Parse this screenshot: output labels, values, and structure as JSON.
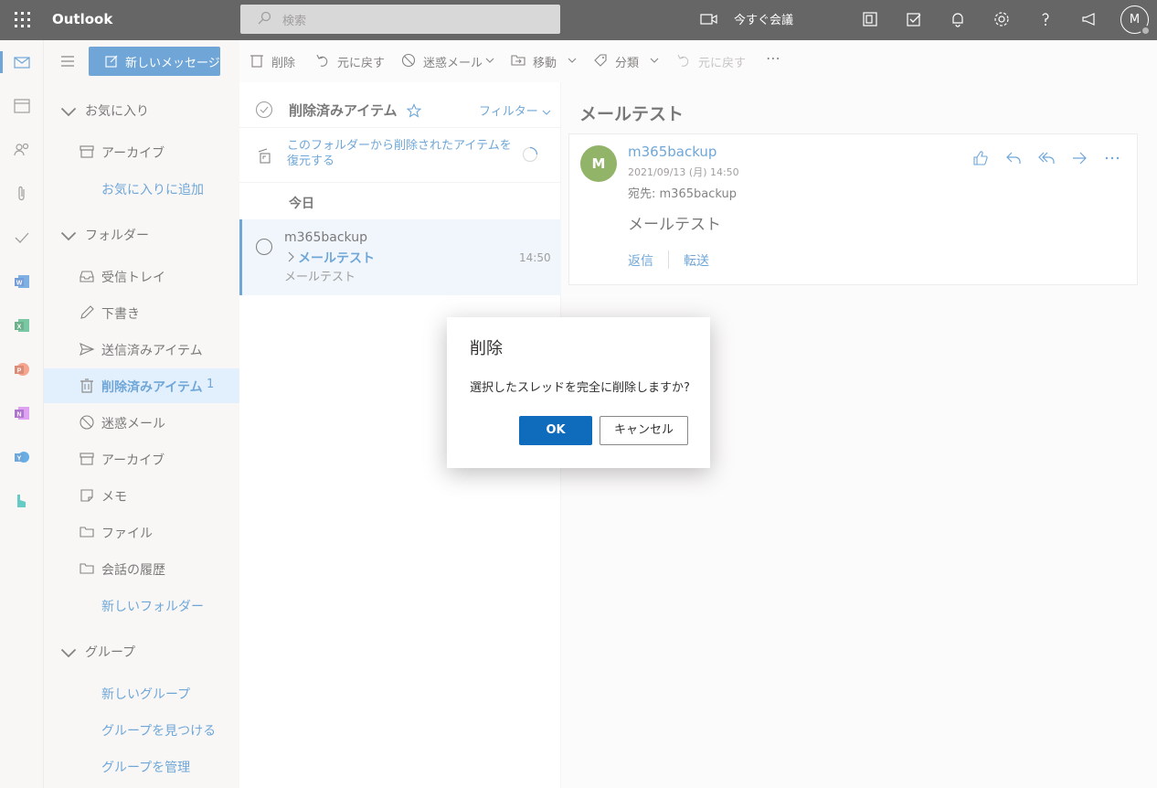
{
  "topbar": {
    "app_name": "Outlook",
    "search_placeholder": "検索",
    "meet_now": "今すぐ会議",
    "avatar_initial": "M"
  },
  "nav": {
    "new_message": "新しいメッセージ",
    "favorites": "お気に入り",
    "archive": "アーカイブ",
    "add_favorite": "お気に入りに追加",
    "folders": "フォルダー",
    "inbox": "受信トレイ",
    "drafts": "下書き",
    "sent": "送信済みアイテム",
    "deleted": "削除済みアイテム",
    "deleted_count": "1",
    "junk": "迷惑メール",
    "archive2": "アーカイブ",
    "notes": "メモ",
    "files": "ファイル",
    "conversation_history": "会話の履歴",
    "new_folder": "新しいフォルダー",
    "groups": "グループ",
    "new_group": "新しいグループ",
    "discover_groups": "グループを見つける",
    "manage_groups": "グループを管理"
  },
  "cmdbar": {
    "delete": "削除",
    "undo": "元に戻す",
    "junk": "迷惑メール",
    "move": "移動",
    "categorize": "分類",
    "undo2": "元に戻す",
    "more": "⋯"
  },
  "list": {
    "folder_title": "削除済みアイテム",
    "filter": "フィルター",
    "restore_text": "このフォルダーから削除されたアイテムを復元する",
    "group_today": "今日",
    "messages": [
      {
        "from": "m365backup",
        "subject": "メールテスト",
        "preview": "メールテスト",
        "time": "14:50"
      }
    ]
  },
  "reading": {
    "subject": "メールテスト",
    "avatar": "M",
    "sender": "m365backup",
    "date": "2021/09/13 (月) 14:50",
    "to": "宛先:  m365backup",
    "body": "メールテスト",
    "reply": "返信",
    "forward": "転送"
  },
  "dialog": {
    "title": "削除",
    "message": "選択したスレッドを完全に削除しますか?",
    "ok": "OK",
    "cancel": "キャンセル"
  },
  "colors": {
    "accent": "#0f6cbd",
    "avatar_bg": "#498205",
    "topbar_bg": "#000000"
  }
}
